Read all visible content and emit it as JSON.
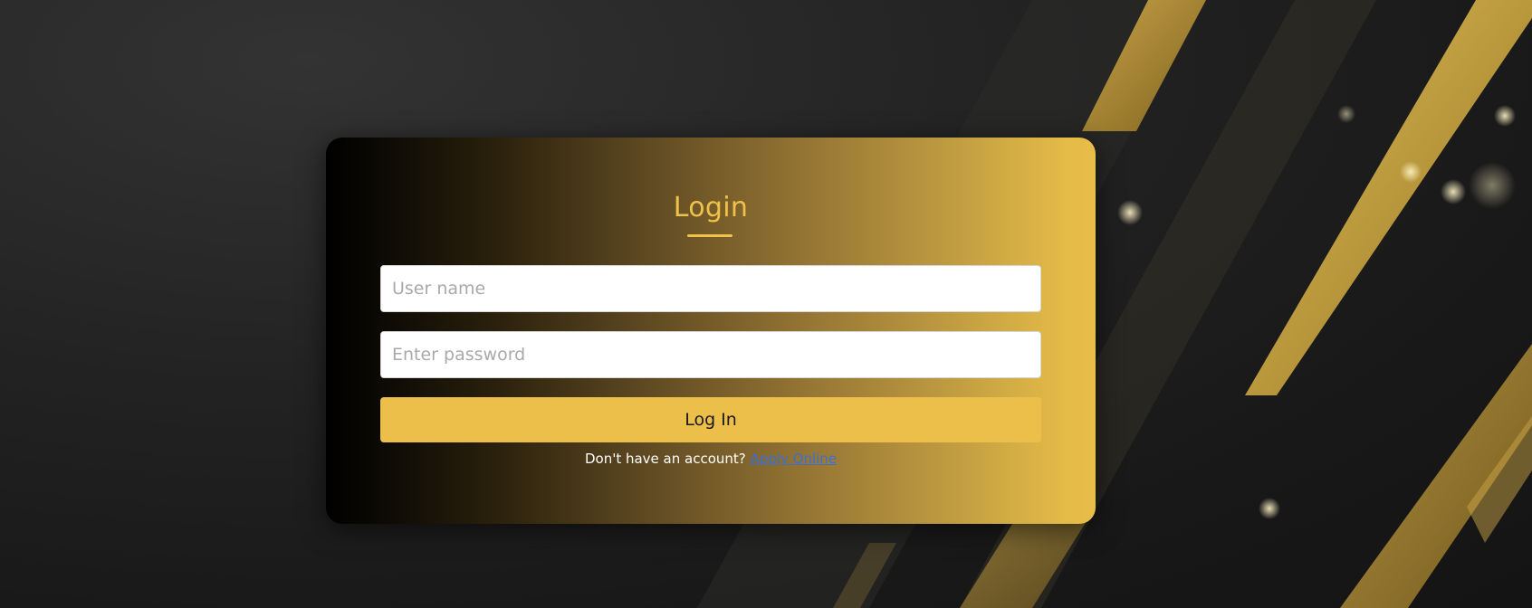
{
  "login": {
    "title": "Login",
    "username_placeholder": "User name",
    "password_placeholder": "Enter password",
    "submit_label": "Log In",
    "signup_prompt": "Don't have an account?",
    "signup_link": "Apply Online"
  },
  "colors": {
    "accent": "#EBBF4A",
    "title": "#F1C24A",
    "link": "#3B6FD6",
    "background": "#1F1F1F"
  }
}
